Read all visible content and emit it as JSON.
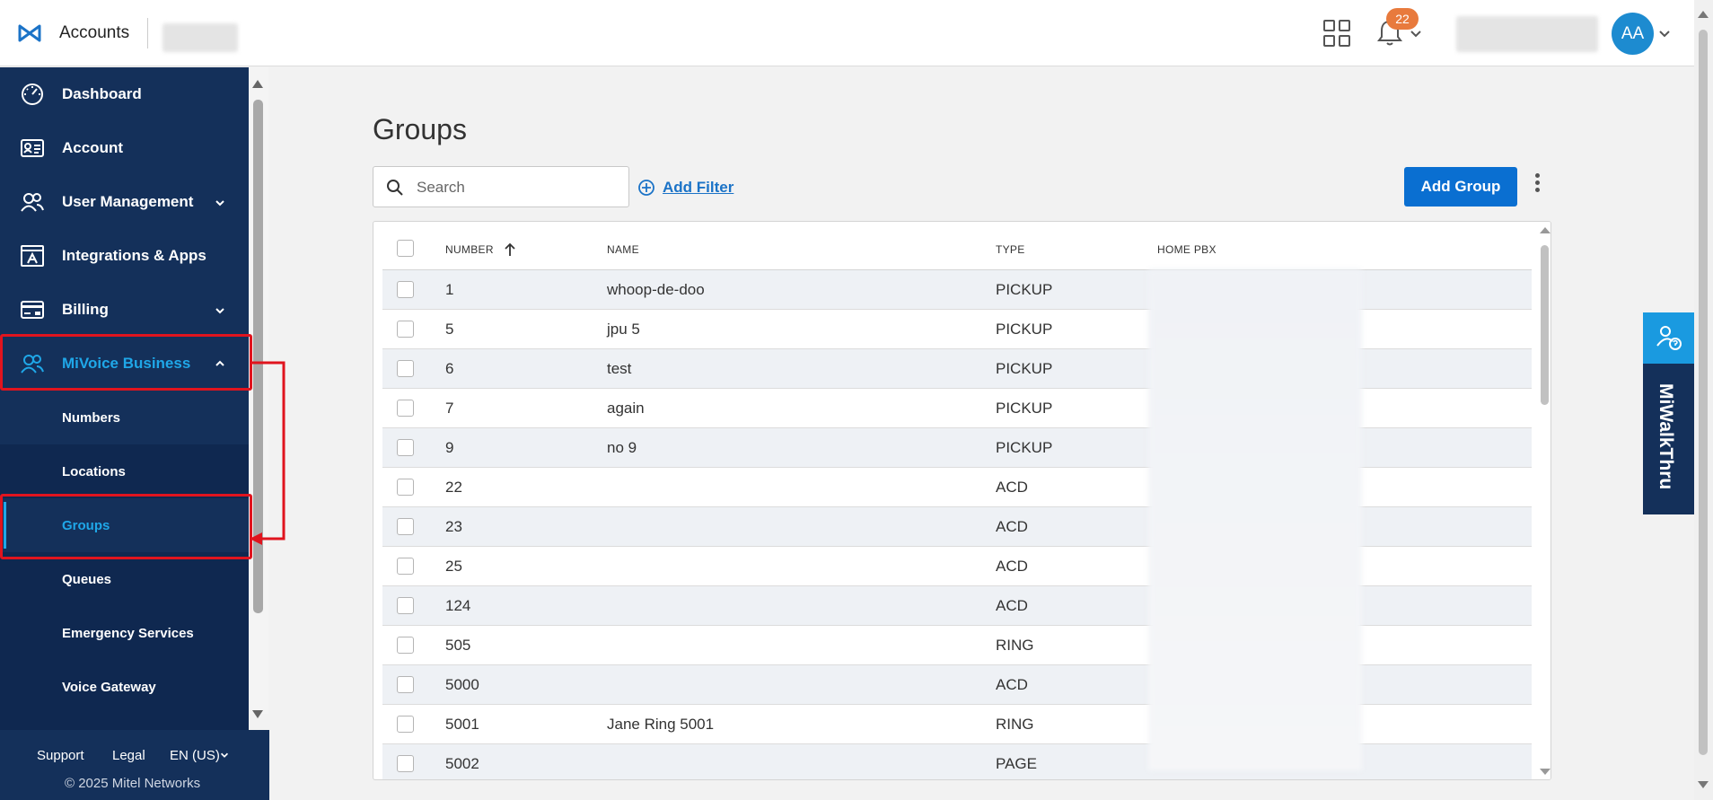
{
  "header": {
    "app_title": "Accounts",
    "notification_count": "22",
    "avatar_initials": "AA"
  },
  "sidebar": {
    "items": [
      {
        "label": "Dashboard",
        "icon": "dashboard-icon"
      },
      {
        "label": "Account",
        "icon": "account-card-icon"
      },
      {
        "label": "User Management",
        "icon": "users-icon",
        "expandable": true
      },
      {
        "label": "Integrations & Apps",
        "icon": "apps-icon"
      },
      {
        "label": "Billing",
        "icon": "billing-card-icon",
        "expandable": true
      },
      {
        "label": "MiVoice Business",
        "icon": "users-icon",
        "expanded": true
      }
    ],
    "sub_items": [
      {
        "label": "Numbers"
      },
      {
        "label": "Locations"
      },
      {
        "label": "Groups",
        "current": true
      },
      {
        "label": "Queues"
      },
      {
        "label": "Emergency Services"
      },
      {
        "label": "Voice Gateway"
      }
    ],
    "footer": {
      "support": "Support",
      "legal": "Legal",
      "language": "EN (US)",
      "copyright": "© 2025 Mitel Networks"
    }
  },
  "main": {
    "title": "Groups",
    "search_placeholder": "Search",
    "add_filter": "Add Filter",
    "add_group": "Add Group",
    "table": {
      "columns": [
        "NUMBER",
        "NAME",
        "TYPE",
        "HOME PBX"
      ],
      "rows": [
        {
          "number": "1",
          "name": "whoop-de-doo",
          "type": "PICKUP"
        },
        {
          "number": "5",
          "name": "jpu 5",
          "type": "PICKUP"
        },
        {
          "number": "6",
          "name": "test",
          "type": "PICKUP"
        },
        {
          "number": "7",
          "name": "again",
          "type": "PICKUP"
        },
        {
          "number": "9",
          "name": "no 9",
          "type": "PICKUP"
        },
        {
          "number": "22",
          "name": "",
          "type": "ACD"
        },
        {
          "number": "23",
          "name": "",
          "type": "ACD"
        },
        {
          "number": "25",
          "name": "",
          "type": "ACD"
        },
        {
          "number": "124",
          "name": "",
          "type": "ACD"
        },
        {
          "number": "505",
          "name": "",
          "type": "RING"
        },
        {
          "number": "5000",
          "name": "",
          "type": "ACD"
        },
        {
          "number": "5001",
          "name": "Jane Ring 5001",
          "type": "RING"
        },
        {
          "number": "5002",
          "name": "",
          "type": "PAGE"
        }
      ]
    }
  },
  "walkthru": {
    "label": "MiWalkThru"
  },
  "colors": {
    "sidebar": "#14305a",
    "accent": "#1fa7e8",
    "primary_button": "#0a6fd1",
    "annotation": "#e0141e",
    "badge": "#e87a3d"
  }
}
